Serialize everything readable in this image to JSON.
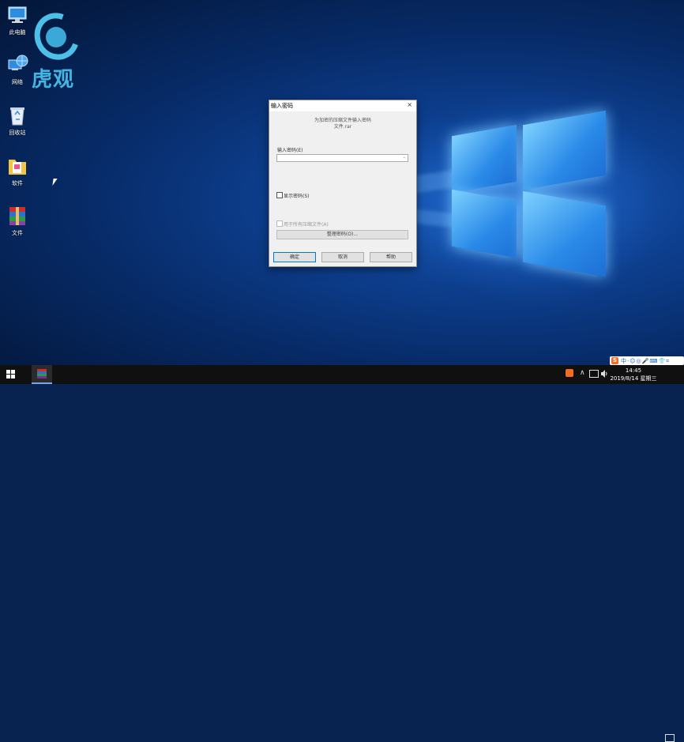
{
  "desktop": {
    "brand": {
      "text": "虎观"
    },
    "icons": [
      {
        "id": "this-pc",
        "label": "此电脑"
      },
      {
        "id": "network",
        "label": "网络"
      },
      {
        "id": "recycle-bin",
        "label": "回收站"
      },
      {
        "id": "software",
        "label": "软件"
      },
      {
        "id": "files",
        "label": "文件"
      }
    ]
  },
  "dialog": {
    "title": "输入密码",
    "close_glyph": "×",
    "message_line1": "为加密的压缩文件输入密码",
    "message_line2": "文件.rar",
    "password_label": "输入密码(E)",
    "password_value": "",
    "combo_arrow": "⌄",
    "show_password_label": "显示密码(S)",
    "use_for_all_label": "用于所有压缩文件(A)",
    "organize_button": "整理密码(O)...",
    "ok_button": "确定",
    "cancel_button": "取消",
    "help_button": "帮助"
  },
  "taskbar": {
    "tray_chevron": "∧",
    "clock_time": "14:45",
    "clock_date": "2019/8/14 星期三",
    "ime_logo": "S",
    "ime_status": "中·☺◎🎤⌨👕⌗"
  }
}
